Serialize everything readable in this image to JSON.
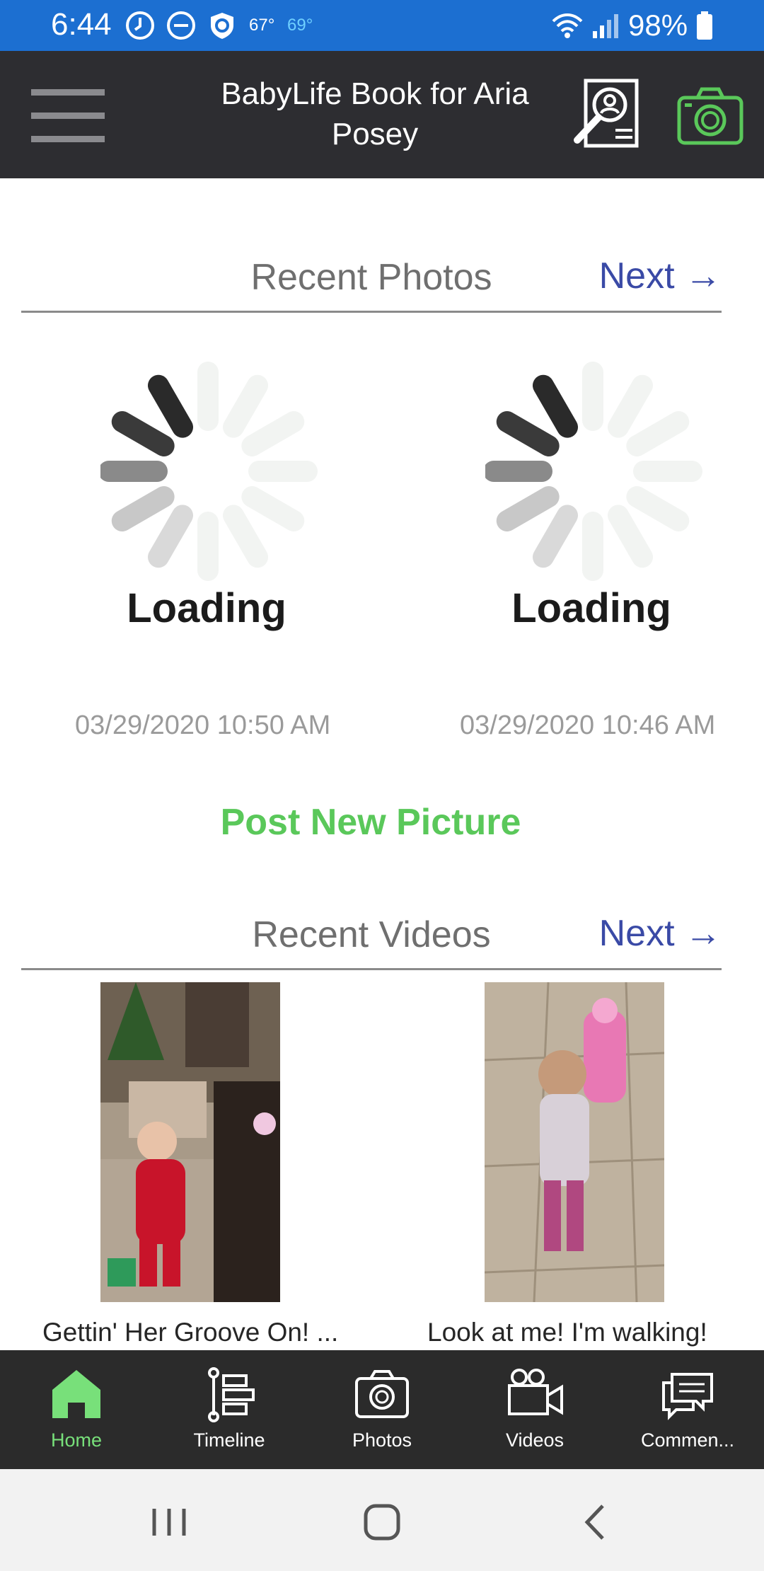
{
  "status_bar": {
    "time": "6:44",
    "temp_primary": "67°",
    "temp_secondary": "69°",
    "battery": "98%",
    "icons": [
      "alarm-icon",
      "dnd-icon",
      "shield-icon",
      "wifi-icon",
      "signal-icon",
      "battery-icon"
    ]
  },
  "app_bar": {
    "title": "BabyLife Book for Aria Posey",
    "icons": [
      "menu-icon",
      "search-book-icon",
      "camera-icon"
    ],
    "accent_color": "#5ac85a"
  },
  "recent_photos": {
    "title": "Recent Photos",
    "next_label": "Next →",
    "items": [
      {
        "loading_label": "Loading",
        "date": "03/29/2020 10:50 AM"
      },
      {
        "loading_label": "Loading",
        "date": "03/29/2020 10:46 AM"
      }
    ],
    "post_label": "Post New Picture"
  },
  "recent_videos": {
    "title": "Recent Videos",
    "next_label": "Next →",
    "items": [
      {
        "caption": "Gettin' Her Groove On! ..."
      },
      {
        "caption": "Look at me! I'm walking!"
      }
    ]
  },
  "bottom_nav": {
    "items": [
      {
        "label": "Home",
        "icon": "home-icon",
        "active": true
      },
      {
        "label": "Timeline",
        "icon": "timeline-icon",
        "active": false
      },
      {
        "label": "Photos",
        "icon": "camera-icon",
        "active": false
      },
      {
        "label": "Videos",
        "icon": "video-camera-icon",
        "active": false
      },
      {
        "label": "Commen...",
        "icon": "comments-icon",
        "active": false
      }
    ]
  },
  "system_nav": {
    "icons": [
      "recent-apps-icon",
      "home-circle-icon",
      "back-icon"
    ]
  }
}
